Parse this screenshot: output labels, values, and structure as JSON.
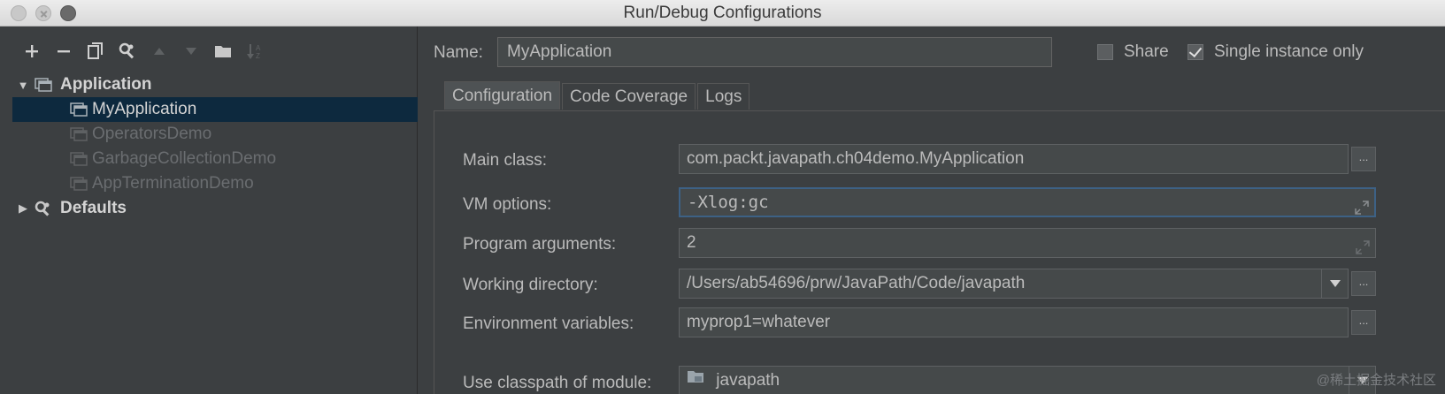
{
  "window": {
    "title": "Run/Debug Configurations"
  },
  "toolbar": {
    "add_icon": "plus-icon",
    "remove_icon": "minus-icon",
    "copy_icon": "copy-icon",
    "edit_defaults_icon": "wrench-icon",
    "move_up_icon": "arrow-up-icon",
    "move_down_icon": "arrow-down-icon",
    "folder_icon": "folder-icon",
    "sort_icon": "sort-icon"
  },
  "tree": {
    "application": {
      "label": "Application",
      "expanded": true,
      "children": [
        {
          "label": "MyApplication",
          "selected": true,
          "enabled": true
        },
        {
          "label": "OperatorsDemo",
          "enabled": false
        },
        {
          "label": "GarbageCollectionDemo",
          "enabled": false
        },
        {
          "label": "AppTerminationDemo",
          "enabled": false
        }
      ]
    },
    "defaults": {
      "label": "Defaults",
      "expanded": false
    }
  },
  "header": {
    "name_label": "Name:",
    "name_value": "MyApplication",
    "share_label": "Share",
    "share_checked": false,
    "single_instance_label": "Single instance only",
    "single_instance_checked": true
  },
  "tabs": [
    {
      "label": "Configuration",
      "active": true
    },
    {
      "label": "Code Coverage",
      "active": false
    },
    {
      "label": "Logs",
      "active": false
    }
  ],
  "form": {
    "main_class": {
      "label": "Main class:",
      "value": "com.packt.javapath.ch04demo.MyApplication",
      "button": "..."
    },
    "vm_options": {
      "label": "VM options:",
      "value": "-Xlog:gc"
    },
    "program_arguments": {
      "label": "Program arguments:",
      "value": "2"
    },
    "working_directory": {
      "label": "Working directory:",
      "value": "/Users/ab54696/prw/JavaPath/Code/javapath",
      "button": "..."
    },
    "environment_variables": {
      "label": "Environment variables:",
      "value": "myprop1=whatever",
      "button": "..."
    },
    "classpath_module": {
      "label": "Use classpath of module:",
      "value": "javapath"
    }
  },
  "watermark": "@稀土掘金技术社区",
  "colors": {
    "background": "#3c3f41",
    "selection": "#0d293e",
    "field_bg": "#45494a",
    "focus_border": "#3d6185",
    "text": "#bbbbbb"
  }
}
